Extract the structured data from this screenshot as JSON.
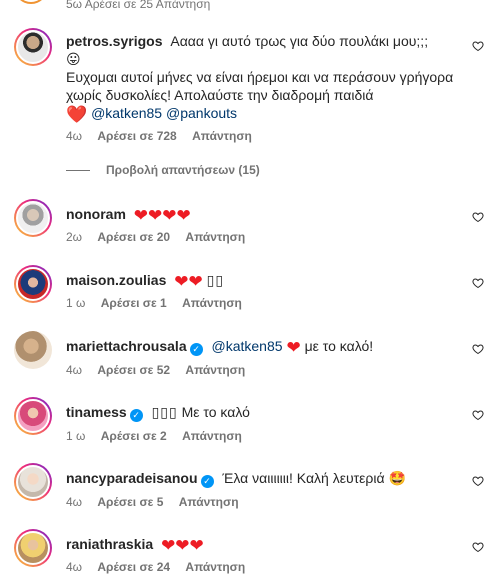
{
  "top_fragment": {
    "meta": "5ω   Αρέσει σε 25   Απάντηση"
  },
  "main_comment": {
    "username": "petros.syrigos",
    "text_line1": "Αααα γι αυτό τρως για δύο πουλάκι μου;;;",
    "emoji1": "😛",
    "text_line2": "Ευχομαι αυτοί μήνες να είναι ήρεμοι και να περάσουν γρήγορα χωρίς δυσκολίες! Απολαύστε την διαδρομή παιδιά",
    "heart": "❤️",
    "mention1": "@katken85",
    "mention2": "@pankouts",
    "time": "4ω",
    "likes": "Αρέσει σε 728",
    "reply": "Απάντηση"
  },
  "view_replies": "Προβολή απαντήσεων (15)",
  "comments": [
    {
      "username": "nonoram",
      "verified": false,
      "text": "❤❤❤❤",
      "time": "2ω",
      "likes": "Αρέσει σε 20",
      "reply": "Απάντηση"
    },
    {
      "username": "maison.zoulias",
      "verified": false,
      "text": "❤❤",
      "text_extra": "▯▯",
      "time": "1 ω",
      "likes": "Αρέσει σε 1",
      "reply": "Απάντηση"
    },
    {
      "username": "mariettachrousala",
      "verified": true,
      "mention": "@katken85",
      "text": "❤",
      "text_extra": "με το καλό!",
      "time": "4ω",
      "likes": "Αρέσει σε 52",
      "reply": "Απάντηση"
    },
    {
      "username": "tinamess",
      "verified": true,
      "text": "▯▯▯",
      "text_extra": "Με το καλό",
      "time": "1 ω",
      "likes": "Αρέσει σε 2",
      "reply": "Απάντηση"
    },
    {
      "username": "nancyparadeisanou",
      "verified": true,
      "text": "Έλα ναιιιιιιι! Καλή λευτεριά",
      "emoji": "🤩",
      "time": "4ω",
      "likes": "Αρέσει σε 5",
      "reply": "Απάντηση"
    },
    {
      "username": "raniathraskia",
      "verified": false,
      "text": "❤❤❤",
      "time": "4ω",
      "likes": "Αρέσει σε 24",
      "reply": "Απάντηση"
    }
  ],
  "colors": {
    "verified": "#0095f6",
    "mention": "#00376b",
    "meta": "#737373",
    "heart": "#ed1c24"
  },
  "icons": {
    "like": "heart-outline-icon",
    "verified": "verified-badge-icon"
  }
}
